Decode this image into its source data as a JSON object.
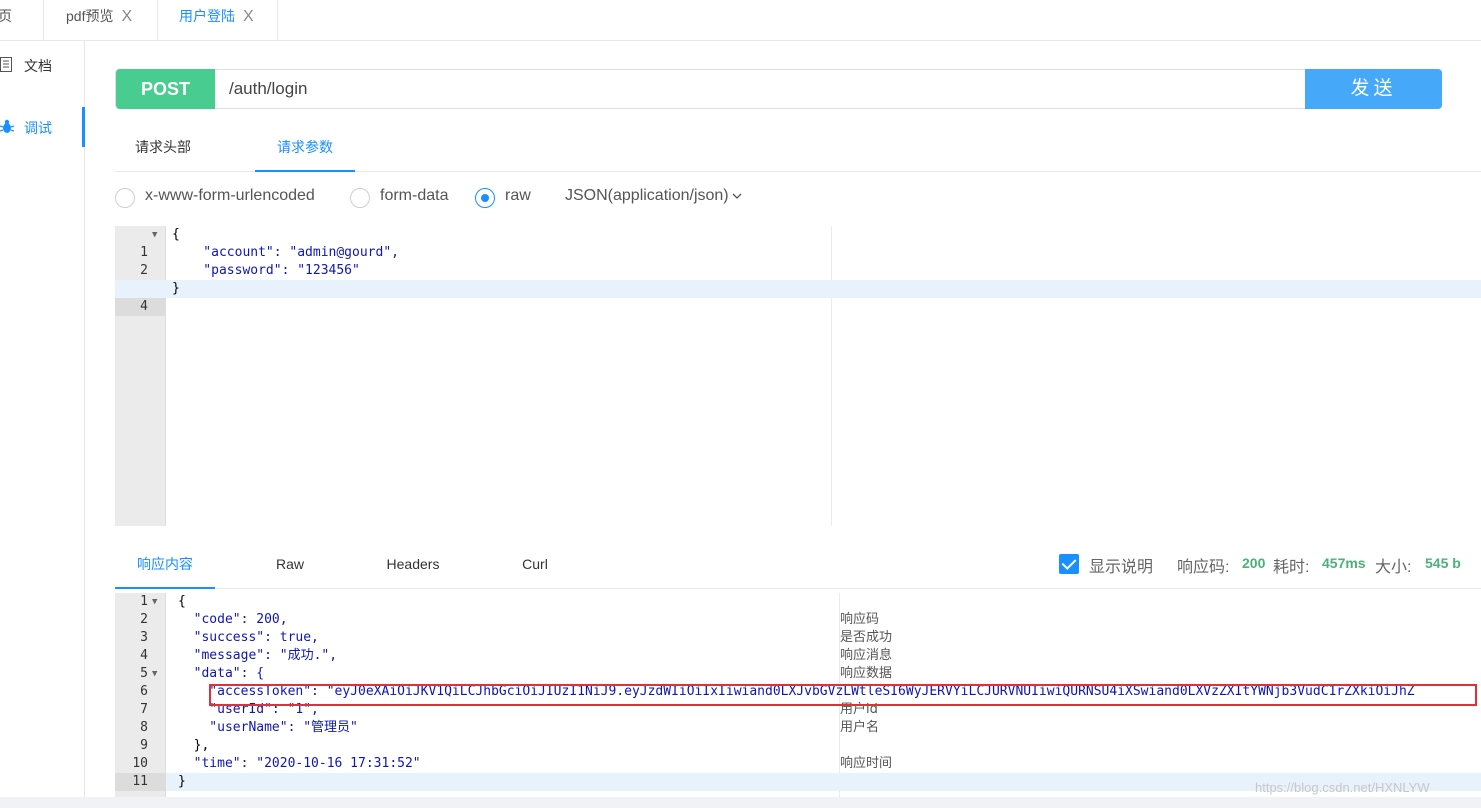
{
  "tabs": [
    {
      "label": "主页",
      "active": false,
      "closable": false
    },
    {
      "label": "pdf预览",
      "active": false,
      "closable": true
    },
    {
      "label": "用户登陆",
      "active": true,
      "closable": true
    }
  ],
  "close_glyph": "X",
  "sidebar": {
    "items": [
      {
        "label": "文档",
        "icon": "document-icon",
        "active": false
      },
      {
        "label": "调试",
        "icon": "bug-icon",
        "active": true
      }
    ]
  },
  "request": {
    "method": "POST",
    "url": "/auth/login",
    "send_label": "发送"
  },
  "request_tabs": [
    {
      "label": "请求头部",
      "active": false
    },
    {
      "label": "请求参数",
      "active": true
    }
  ],
  "body_types": [
    {
      "label": "x-www-form-urlencoded",
      "checked": false
    },
    {
      "label": "form-data",
      "checked": false
    },
    {
      "label": "raw",
      "checked": true
    }
  ],
  "content_type": "JSON(application/json)",
  "request_body": [
    "{",
    "    \"account\": \"admin@gourd\",",
    "    \"password\": \"123456\"",
    "}"
  ],
  "response_tabs": [
    {
      "label": "响应内容",
      "active": true
    },
    {
      "label": "Raw",
      "active": false
    },
    {
      "label": "Headers",
      "active": false
    },
    {
      "label": "Curl",
      "active": false
    }
  ],
  "response_stats": {
    "show_desc_label": "显示说明",
    "show_desc_checked": true,
    "code_label": "响应码:",
    "code_value": "200",
    "time_label": "耗时:",
    "time_value": "457ms",
    "size_label": "大小:",
    "size_value": "545 b"
  },
  "response_body": [
    {
      "n": "1",
      "fold": true,
      "text": "{",
      "comment": ""
    },
    {
      "n": "2",
      "fold": false,
      "text": "  \"code\": 200,",
      "comment": "响应码"
    },
    {
      "n": "3",
      "fold": false,
      "text": "  \"success\": true,",
      "comment": "是否成功"
    },
    {
      "n": "4",
      "fold": false,
      "text": "  \"message\": \"成功.\",",
      "comment": "响应消息"
    },
    {
      "n": "5",
      "fold": true,
      "text": "  \"data\": {",
      "comment": "响应数据"
    },
    {
      "n": "6",
      "fold": false,
      "text": "    \"accessToken\": \"eyJ0eXAiOiJKV1QiLCJhbGciOiJIUzI1NiJ9.eyJzdWIiOiIxIiwiand0LXJvbGVzLWtleSI6WyJERVYiLCJURVNUIiwiQURNSU4iXSwiand0LXVzZXItYWNjb3VudC1rZXkiOiJhZ",
      "comment": ""
    },
    {
      "n": "7",
      "fold": false,
      "text": "    \"userId\": \"1\",",
      "comment": "用户id"
    },
    {
      "n": "8",
      "fold": false,
      "text": "    \"userName\": \"管理员\"",
      "comment": "用户名"
    },
    {
      "n": "9",
      "fold": false,
      "text": "  },",
      "comment": ""
    },
    {
      "n": "10",
      "fold": false,
      "text": "  \"time\": \"2020-10-16 17:31:52\"",
      "comment": "响应时间"
    },
    {
      "n": "11",
      "fold": false,
      "text": "}",
      "comment": ""
    }
  ],
  "watermark": "https://blog.csdn.net/HXNLYW"
}
